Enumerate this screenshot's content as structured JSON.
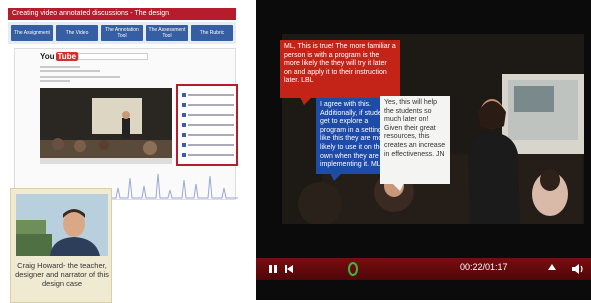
{
  "design": {
    "header_title": "Creating video annotated discussions - The design",
    "nav_tabs": [
      "The Assignment",
      "The Video",
      "The Annotation Tool",
      "The Assessment Tool",
      "The Rubric"
    ],
    "youtube_logo": [
      "You",
      "Tube"
    ],
    "profile_caption": "Craig Howard- the teacher, designer and narrator of this design case"
  },
  "player": {
    "annotations": [
      "ML, This is true! The more familiar a person is with a program is the more likely the they will try it later on and apply it to their instruction later. LBL",
      "I agree with this. Additionally, if students get to explore a program in a setting like this they are more likely to use it on their own when they are implementing it. ML",
      "Yes, this will help the students so much later on! Given their great resources, this creates an increase in effectiveness. JN"
    ],
    "time": "00:22/01:17",
    "progress_fraction": 0.29
  },
  "colors": {
    "brand_red": "#b71c2c",
    "player_bar": "#7a0d10",
    "annotation_red": "#c42418",
    "annotation_blue": "#1e4aa8",
    "annotation_white": "#f4f4f2",
    "progress_green": "#3fb541"
  },
  "icons": {
    "play_pause": "pause-icon",
    "skip_back": "skip-back-icon",
    "volume": "volume-icon"
  }
}
